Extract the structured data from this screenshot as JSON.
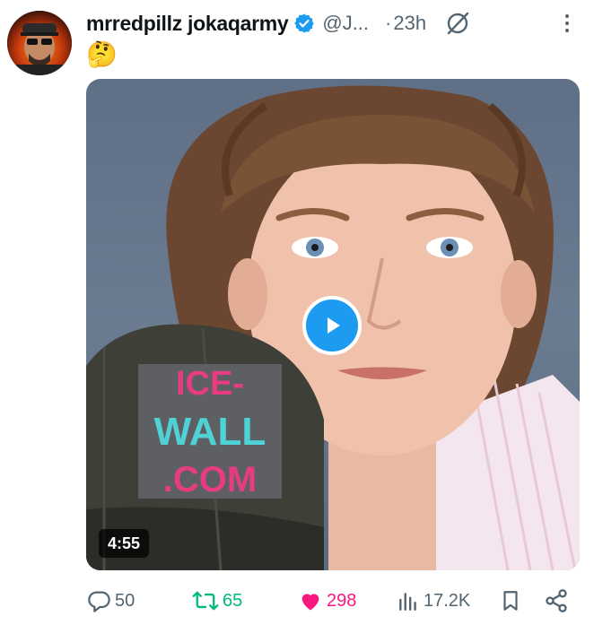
{
  "post": {
    "display_name": "mrredpillz jokaqarmy",
    "handle": "@J...",
    "separator": "·",
    "time": "23h",
    "text": "🤔"
  },
  "media": {
    "duration": "4:55",
    "cap_text_line1": "ICE-",
    "cap_text_line2": "WALL",
    "cap_text_line3": ".COM"
  },
  "actions": {
    "replies": "50",
    "reposts": "65",
    "likes": "298",
    "views": "17.2K"
  },
  "colors": {
    "verified": "#1d9bf0",
    "repost_active": "#00ba7c",
    "like_active": "#f91880",
    "muted": "#536471"
  },
  "icons": [
    "verified-badge-icon",
    "grok-icon",
    "more-icon",
    "play-icon",
    "reply-icon",
    "repost-icon",
    "like-icon",
    "views-icon",
    "bookmark-icon",
    "share-icon"
  ]
}
